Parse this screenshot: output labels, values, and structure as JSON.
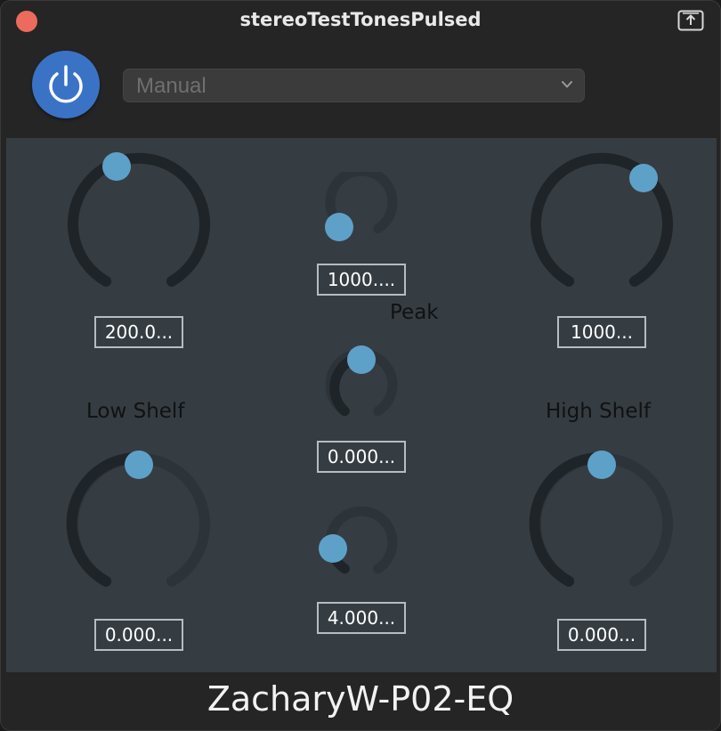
{
  "window": {
    "title": "stereoTestTonesPulsed"
  },
  "toolbar": {
    "preset": {
      "value": "Manual"
    }
  },
  "low_shelf": {
    "label": "Low Shelf",
    "freq_value": "200.0...",
    "gain_value": "0.000..."
  },
  "peak": {
    "label": "Peak",
    "freq_value": "1000....",
    "gain_value": "0.000...",
    "q_value": "4.000..."
  },
  "high_shelf": {
    "label": "High Shelf",
    "freq_value": "1000...",
    "gain_value": "0.000..."
  },
  "footer": {
    "title": "ZacharyW-P02-EQ"
  },
  "colors": {
    "accent": "#3a73c6",
    "knob_thumb": "#5ea1c8",
    "knob_track": "#1e2428",
    "panel": "#353d43",
    "close": "#ec6a5e"
  }
}
